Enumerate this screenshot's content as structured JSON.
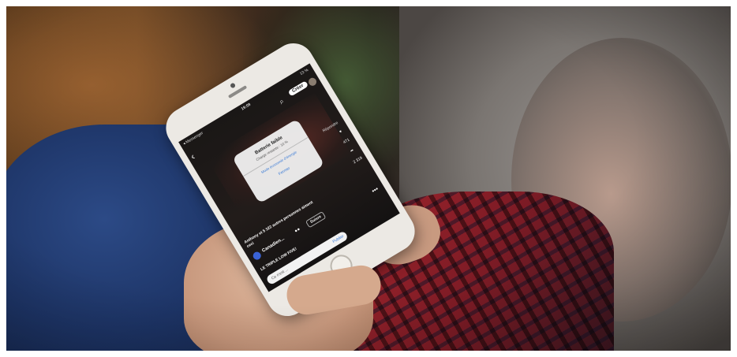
{
  "scene": {
    "subject": "",
    "colors": {
      "wood": "#6a4523",
      "jeans": "#1d3466",
      "shirt_red": "#a0242c",
      "phone_body": "#ece9e4",
      "accent_blue": "#3b7bd6"
    }
  },
  "phone_screen": {
    "status_bar": {
      "back_app": "◂ Messenger",
      "time": "19:09",
      "battery": "13 %"
    },
    "top_bar": {
      "back_icon": "‹",
      "search_icon": "⌕",
      "create_label": "Créer"
    },
    "battery_alert": {
      "title": "Batterie faible",
      "body": "Charge restante : 10 %",
      "action_low_power": "Mode économie d'énergie",
      "action_close": "Fermer"
    },
    "side_actions": {
      "likes": "471",
      "comments": "2 319"
    },
    "reply_tag": "Répondre",
    "likers_text": "Anthony et 5 322 autres personnes aiment ceci",
    "author": {
      "name": "Canadien...",
      "follow_label": "Suivre"
    },
    "caption": "LE TRIPLE LOW FIVE!",
    "comment_bar": {
      "placeholder": "Ce n'est ...",
      "send_label": "Publier"
    },
    "more_icon": "•••"
  }
}
